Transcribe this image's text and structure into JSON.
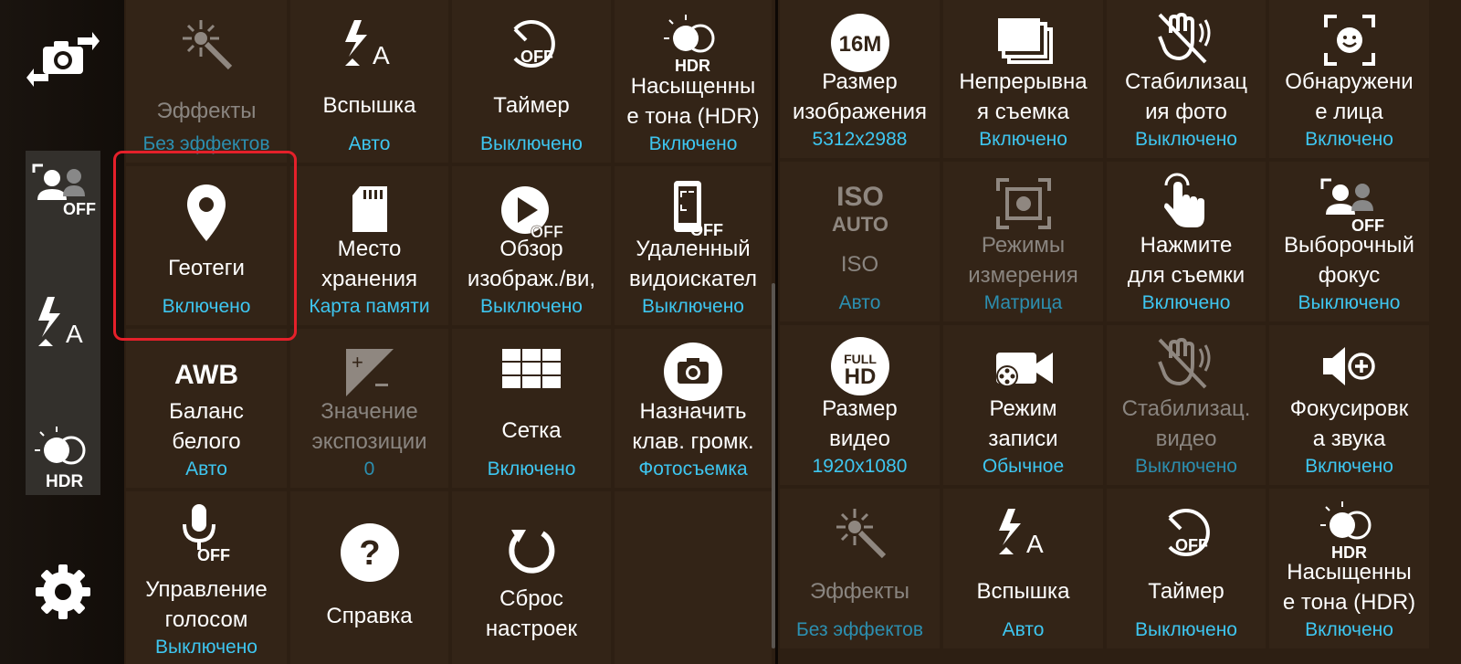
{
  "sidebar": {
    "items": [
      {
        "name": "switch-camera",
        "label": ""
      },
      {
        "name": "selective-focus-off",
        "label": "OFF"
      },
      {
        "name": "flash-auto",
        "label": "A"
      },
      {
        "name": "hdr",
        "label": "HDR"
      },
      {
        "name": "settings",
        "label": ""
      }
    ]
  },
  "left_panel": {
    "tiles": [
      {
        "label": "Эффекты",
        "value": "Без эффектов",
        "icon": "effects-icon",
        "disabled": true
      },
      {
        "label": "Вспышка",
        "value": "Авто",
        "icon": "flash-auto-icon"
      },
      {
        "label": "Таймер",
        "value": "Выключено",
        "icon": "timer-off-icon"
      },
      {
        "label1": "Насыщенны",
        "label2": "е тона (HDR)",
        "value": "Включено",
        "icon": "hdr-icon"
      },
      {
        "label": "Геотеги",
        "value": "Включено",
        "icon": "location-pin-icon"
      },
      {
        "label1": "Место",
        "label2": "хранения",
        "value": "Карта памяти",
        "icon": "sd-card-icon"
      },
      {
        "label1": "Обзор",
        "label2": "изображ./ви,",
        "value": "Выключено",
        "icon": "review-off-icon"
      },
      {
        "label1": "Удаленный",
        "label2": "видоискател",
        "value": "Выключено",
        "icon": "remote-viewfinder-off-icon"
      },
      {
        "label1": "Баланс",
        "label2": "белого",
        "value": "Авто",
        "icon": "awb-icon",
        "icon_text": "AWB"
      },
      {
        "label1": "Значение",
        "label2": "экспозиции",
        "value": "0",
        "icon": "exposure-icon",
        "disabled": true
      },
      {
        "label": "Сетка",
        "value": "Включено",
        "icon": "grid-icon"
      },
      {
        "label1": "Назначить",
        "label2": "клав. громк.",
        "value": "Фотосъемка",
        "icon": "camera-icon"
      },
      {
        "label1": "Управление",
        "label2": "голосом",
        "value": "Выключено",
        "icon": "voice-control-off-icon"
      },
      {
        "label": "Справка",
        "value": "",
        "icon": "help-icon"
      },
      {
        "label1": "Сброс",
        "label2": "настроек",
        "value": "",
        "icon": "reset-icon"
      }
    ]
  },
  "right_panel": {
    "tiles": [
      {
        "label1": "Размер",
        "label2": "изображения",
        "value": "5312x2988",
        "icon": "picture-size-icon",
        "icon_text": "16M"
      },
      {
        "label1": "Непрерывна",
        "label2": "я съемка",
        "value": "Включено",
        "icon": "burst-shot-icon"
      },
      {
        "label1": "Стабилизац",
        "label2": "ия фото",
        "value": "Выключено",
        "icon": "photo-stabilization-off-icon"
      },
      {
        "label1": "Обнаружени",
        "label2": "е лица",
        "value": "Включено",
        "icon": "face-detection-icon"
      },
      {
        "label": "ISO",
        "value": "Авто",
        "icon": "iso-auto-icon",
        "icon_text1": "ISO",
        "icon_text2": "AUTO",
        "disabled": true
      },
      {
        "label1": "Режимы",
        "label2": "измерения",
        "value": "Матрица",
        "icon": "metering-icon",
        "disabled": true
      },
      {
        "label1": "Нажмите",
        "label2": "для съемки",
        "value": "Включено",
        "icon": "tap-to-take-icon"
      },
      {
        "label1": "Выборочный",
        "label2": "фокус",
        "value": "Выключено",
        "icon": "selective-focus-off-icon"
      },
      {
        "label1": "Размер",
        "label2": "видео",
        "value": "1920x1080",
        "icon": "video-size-icon",
        "icon_text1": "FULL",
        "icon_text2": "HD"
      },
      {
        "label1": "Режим",
        "label2": "записи",
        "value": "Обычное",
        "icon": "recording-mode-icon"
      },
      {
        "label1": "Стабилизац.",
        "label2": "видео",
        "value": "Выключено",
        "icon": "video-stabilization-icon",
        "disabled": true
      },
      {
        "label1": "Фокусировк",
        "label2": "а звука",
        "value": "Включено",
        "icon": "audio-zoom-icon"
      },
      {
        "label": "Эффекты",
        "value": "Без эффектов",
        "icon": "effects-icon",
        "disabled": true
      },
      {
        "label": "Вспышка",
        "value": "Авто",
        "icon": "flash-auto-icon"
      },
      {
        "label": "Таймер",
        "value": "Выключено",
        "icon": "timer-off-icon"
      },
      {
        "label1": "Насыщенны",
        "label2": "е тона (HDR)",
        "value": "Включено",
        "icon": "hdr-icon"
      }
    ]
  },
  "icon_labels": {
    "off": "OFF",
    "auto_a": "A",
    "hdr": "HDR",
    "help": "?"
  },
  "colors": {
    "accent": "#3ec6f0",
    "highlight": "#e5202a",
    "tile_bg": "#332417"
  }
}
